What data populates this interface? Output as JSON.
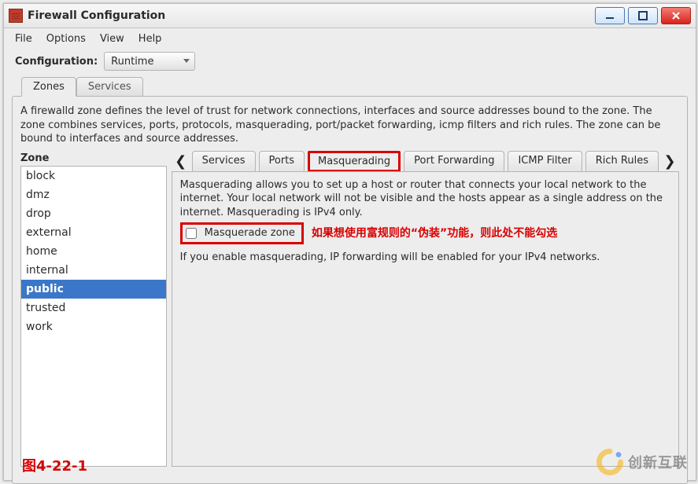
{
  "window": {
    "title": "Firewall Configuration"
  },
  "menu": {
    "file": "File",
    "options": "Options",
    "view": "View",
    "help": "Help"
  },
  "config": {
    "label": "Configuration:",
    "value": "Runtime"
  },
  "top_tabs": {
    "zones": "Zones",
    "services": "Services"
  },
  "zones_description": "A firewalld zone defines the level of trust for network connections, interfaces and source addresses bound to the zone. The zone combines services, ports, protocols, masquerading, port/packet forwarding, icmp filters and rich rules. The zone can be bound to interfaces and source addresses.",
  "zone": {
    "heading": "Zone",
    "items": [
      {
        "label": "block"
      },
      {
        "label": "dmz"
      },
      {
        "label": "drop"
      },
      {
        "label": "external"
      },
      {
        "label": "home"
      },
      {
        "label": "internal"
      },
      {
        "label": "public"
      },
      {
        "label": "trusted"
      },
      {
        "label": "work"
      }
    ],
    "selected_index": 6
  },
  "inner_tabs": {
    "services": "Services",
    "ports": "Ports",
    "masquerading": "Masquerading",
    "port_forwarding": "Port Forwarding",
    "icmp_filter": "ICMP Filter",
    "rich_rules": "Rich Rules"
  },
  "masquerading": {
    "description": "Masquerading allows you to set up a host or router that connects your local network to the internet. Your local network will not be visible and the hosts appear as a single address on the internet. Masquerading is IPv4 only.",
    "checkbox_label": "Masquerade zone",
    "red_note": "如果想使用富规则的“伪装”功能，则此处不能勾选",
    "forward_note": "If you enable masquerading, IP forwarding will be enabled for your IPv4 networks."
  },
  "figure_caption": "图4-22-1",
  "watermark": "创新互联"
}
